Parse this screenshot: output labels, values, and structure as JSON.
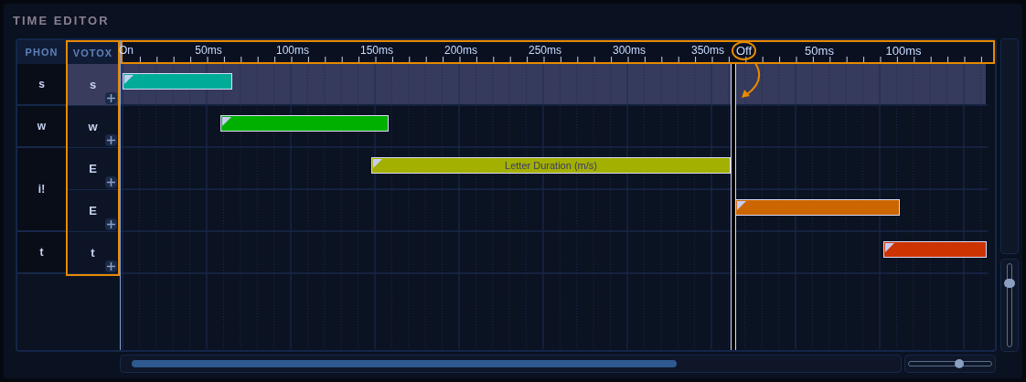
{
  "panel": {
    "title": "TIME EDITOR"
  },
  "columns": [
    "PHON",
    "VOTOX"
  ],
  "vertical_zoom": {
    "level": 0.8
  },
  "horizontal_zoom": {
    "level": 0.6
  },
  "ruler": {
    "labels": [
      "On",
      "50ms",
      "100ms",
      "150ms",
      "200ms",
      "250ms",
      "300ms",
      "350ms"
    ],
    "marker": "Off",
    "after_labels": [
      "50ms",
      "100ms"
    ]
  },
  "phonemes": [
    {
      "label": "s",
      "votox": [
        {
          "label": "s",
          "selected": true,
          "color": "#00ab98"
        }
      ]
    },
    {
      "label": "w",
      "votox": [
        {
          "label": "w",
          "selected": false,
          "color": "#00b000"
        }
      ]
    },
    {
      "label": "i!",
      "votox": [
        {
          "label": "E",
          "selected": false,
          "color": "#a3b000",
          "bar_label": "Letter Duration (m/s)"
        },
        {
          "label": "E",
          "selected": false,
          "color": "#cc6600"
        }
      ]
    },
    {
      "label": "t",
      "votox": [
        {
          "label": "t",
          "selected": false,
          "color": "#cc3300"
        }
      ]
    }
  ]
}
